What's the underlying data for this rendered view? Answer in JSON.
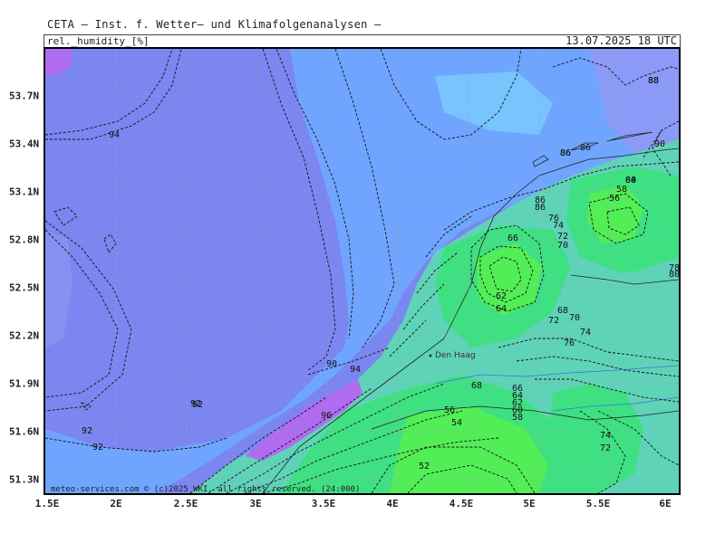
{
  "header": {
    "title": "CETA — Inst. f. Wetter— und Klimafolgenanalysen —",
    "variable": "rel._humidity_[%]",
    "datetime": "13.07.2025  18 UTC"
  },
  "axes": {
    "lat_labels": [
      "53.7N",
      "53.4N",
      "53.1N",
      "52.8N",
      "52.5N",
      "52.2N",
      "51.9N",
      "51.6N",
      "51.3N"
    ],
    "lon_labels": [
      "1.5E",
      "2E",
      "2.5E",
      "3E",
      "3.5E",
      "4E",
      "4.5E",
      "5E",
      "5.5E",
      "6E"
    ]
  },
  "contour_labels": [
    "94",
    "92",
    "92",
    "92",
    "88",
    "86",
    "86",
    "90",
    "86",
    "86",
    "76",
    "74",
    "72",
    "70",
    "66",
    "62",
    "64",
    "58",
    "56",
    "60",
    "68",
    "70",
    "72",
    "74",
    "76",
    "80",
    "78",
    "66",
    "64",
    "62",
    "60",
    "58",
    "56",
    "54",
    "52",
    "68",
    "74",
    "72",
    "90",
    "94",
    "92",
    "96",
    "88",
    "86",
    "84"
  ],
  "place_labels": [
    "Den Haag"
  ],
  "footer": {
    "copyright": "meteo-services.com © (c)2025 WKI. all rights reserved. (24:000)"
  },
  "colors": {
    "very_humid": "#7b86f0",
    "humid": "#6fa5ff",
    "moderate": "#72c8ff",
    "mid": "#5fd6c0",
    "dry_mid": "#3fe08c",
    "dry": "#3ef05a",
    "saturated": "#b06cf0"
  }
}
